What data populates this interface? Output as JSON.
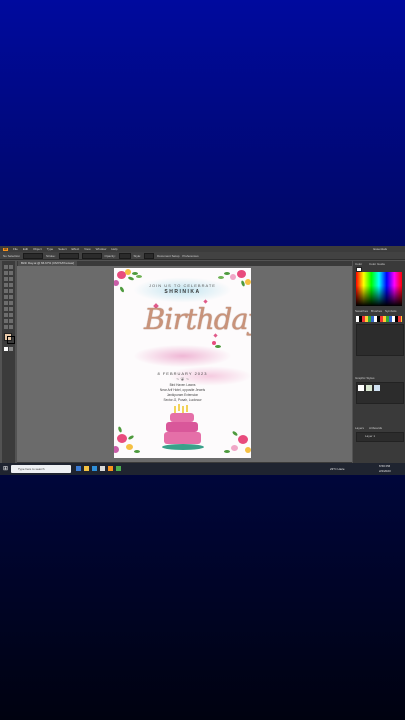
{
  "app": {
    "logo": "Ai",
    "menu": [
      "File",
      "Edit",
      "Object",
      "Type",
      "Select",
      "Effect",
      "View",
      "Window",
      "Help"
    ],
    "workspace": "Essentials"
  },
  "options_bar": {
    "selection_label": "No Selection",
    "stroke_label": "Stroke:",
    "opacity_label": "Opacity:",
    "style_label": "Style:",
    "document_setup": "Document Setup",
    "preferences": "Preferences"
  },
  "document_tab": {
    "label": "Birth Day.ai @ 66.67% (CMYK/Preview)"
  },
  "invitation": {
    "line1": "JOIN US TO CELEBRATE",
    "name": "SHRINIKA",
    "script_title": "Birthday",
    "date": "8 FEBRUARY 2023",
    "venue_line1": "Bird Haven Lawns",
    "venue_line2": "Near Arif Hotel, opposite Jewels",
    "venue_line3": "Jankipuram Extension",
    "venue_line4": "Sector-G, Pusah, Lucknow"
  },
  "panels": {
    "color_title": "Color",
    "color_guide_title": "Color Guide",
    "swatches_title": "Swatches",
    "brushes_title": "Brushes",
    "symbols_title": "Symbols",
    "graphic_styles_title": "Graphic Styles",
    "layers_title": "Layers",
    "artboards_title": "Artboards",
    "layers_row": "Layer 1"
  },
  "taskbar": {
    "search_placeholder": "Type here to search",
    "weather": "23°C Haze",
    "time": "6:50 PM",
    "date": "2/2/2023"
  },
  "colors": {
    "accent_rose_gold": "#c9937a",
    "pink_wash": "#eba0c8",
    "blue_wash": "#aadceb",
    "ui_dark": "#3a3a3a",
    "canvas_grey": "#6b6b6b"
  }
}
